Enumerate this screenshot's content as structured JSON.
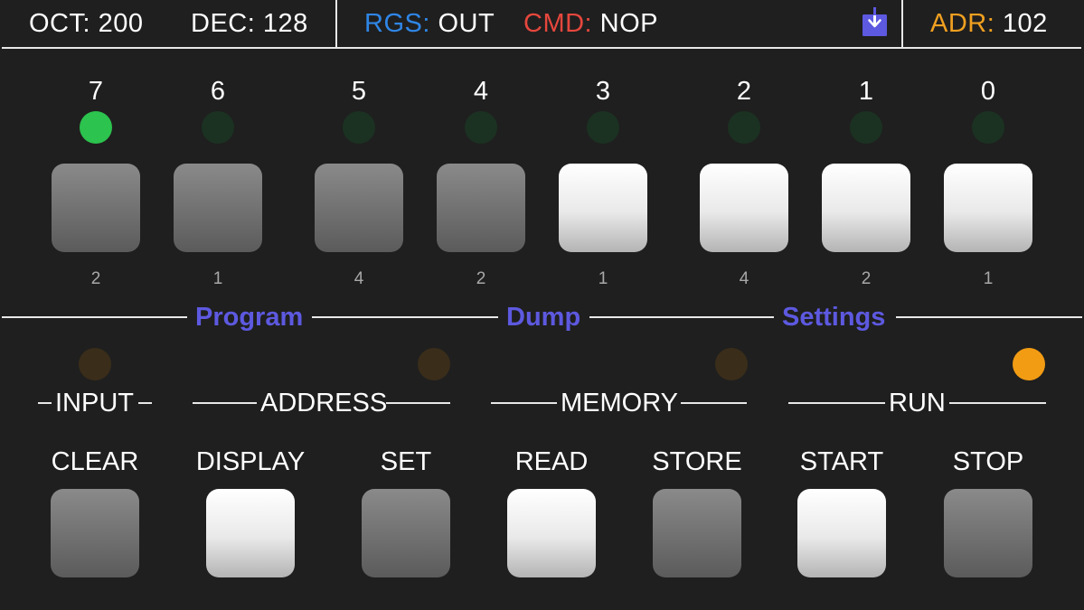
{
  "header": {
    "oct_label": "OCT:",
    "oct_value": "200",
    "dec_label": "DEC:",
    "dec_value": "128",
    "rgs_label": "RGS:",
    "rgs_value": "OUT",
    "cmd_label": "CMD:",
    "cmd_value": "NOP",
    "download_icon": "download-icon",
    "adr_label": "ADR:",
    "adr_value": "102"
  },
  "colors": {
    "rgs_label": "#2f86e6",
    "cmd_label": "#e6473d",
    "adr_label": "#f0a020",
    "accent": "#5d59e0",
    "led_on_green": "#2cc34e",
    "led_on_amber": "#f29c14"
  },
  "bits": [
    {
      "number": "7",
      "led_on": true,
      "pressed": false,
      "weight": "2"
    },
    {
      "number": "6",
      "led_on": false,
      "pressed": false,
      "weight": "1"
    },
    {
      "number": "5",
      "led_on": false,
      "pressed": false,
      "weight": "4"
    },
    {
      "number": "4",
      "led_on": false,
      "pressed": false,
      "weight": "2"
    },
    {
      "number": "3",
      "led_on": false,
      "pressed": true,
      "weight": "1"
    },
    {
      "number": "2",
      "led_on": false,
      "pressed": true,
      "weight": "4"
    },
    {
      "number": "1",
      "led_on": false,
      "pressed": true,
      "weight": "2"
    },
    {
      "number": "0",
      "led_on": false,
      "pressed": true,
      "weight": "1"
    }
  ],
  "menu": {
    "program": "Program",
    "dump": "Dump",
    "settings": "Settings"
  },
  "groups": [
    {
      "label": "INPUT",
      "led_on": false
    },
    {
      "label": "ADDRESS",
      "led_on": false
    },
    {
      "label": "MEMORY",
      "led_on": false
    },
    {
      "label": "RUN",
      "led_on": true
    }
  ],
  "commands": [
    {
      "label": "CLEAR",
      "pressed": false
    },
    {
      "label": "DISPLAY",
      "pressed": true
    },
    {
      "label": "SET",
      "pressed": false
    },
    {
      "label": "READ",
      "pressed": true
    },
    {
      "label": "STORE",
      "pressed": false
    },
    {
      "label": "START",
      "pressed": true
    },
    {
      "label": "STOP",
      "pressed": false
    }
  ]
}
